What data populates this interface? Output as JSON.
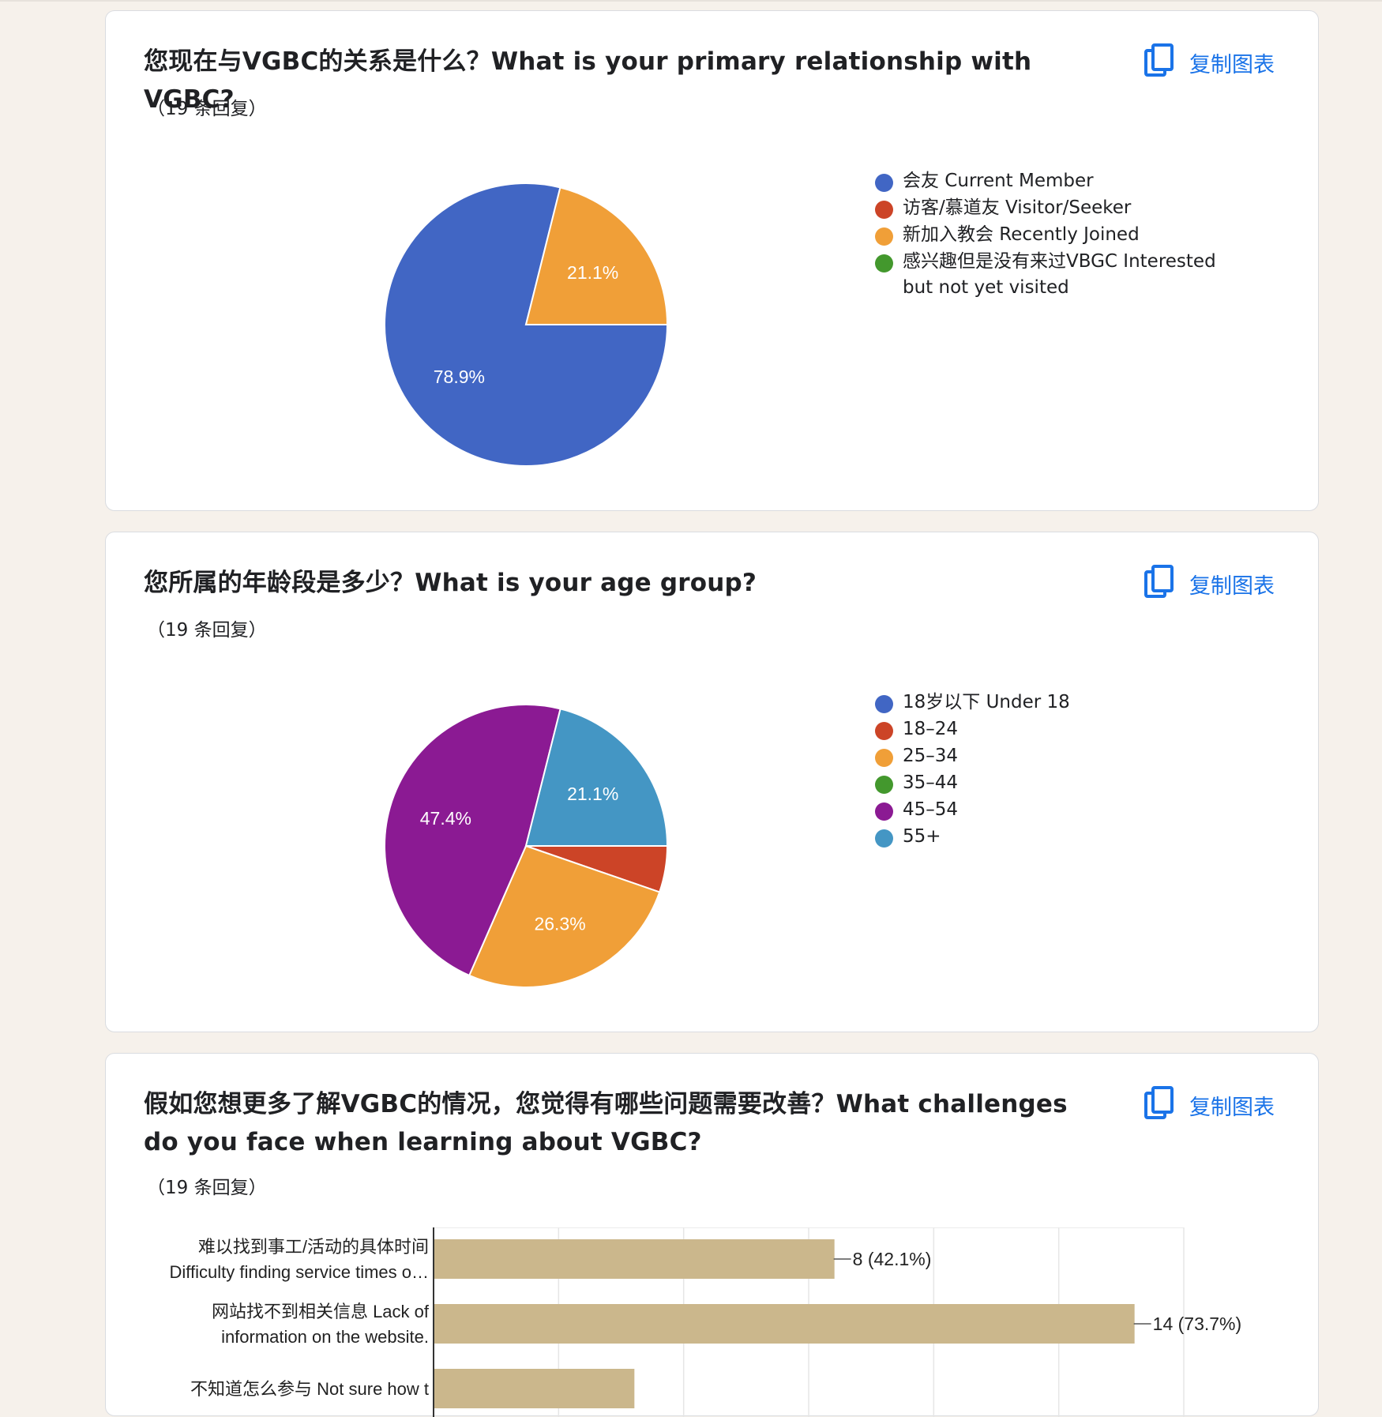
{
  "cards": [
    {
      "title": "您现在与VGBC的关系是什么？What is your primary relationship with VGBC?",
      "responses": "（19 条回复）",
      "copy_label": "复制图表",
      "legend": [
        {
          "label": "会友 Current Member",
          "color": "#4166c4"
        },
        {
          "label": "访客/慕道友 Visitor/Seeker",
          "color": "#cc4427"
        },
        {
          "label": "新加入教会 Recently Joined",
          "color": "#f09f38"
        },
        {
          "label": "感兴趣但是没有来过VBGC Interested but not yet visited",
          "color": "#43982d"
        }
      ]
    },
    {
      "title": "您所属的年龄段是多少？What is your age group?",
      "responses": "（19 条回复）",
      "copy_label": "复制图表",
      "legend": [
        {
          "label": "18岁以下 Under 18",
          "color": "#4166c4"
        },
        {
          "label": "18–24",
          "color": "#cc4427"
        },
        {
          "label": "25–34",
          "color": "#f09f38"
        },
        {
          "label": "35–44",
          "color": "#43982d"
        },
        {
          "label": "45–54",
          "color": "#8b1a93"
        },
        {
          "label": "55+",
          "color": "#4496c4"
        }
      ]
    },
    {
      "title": "假如您想更多了解VGBC的情况，您觉得有哪些问题需要改善？What challenges do you face when learning about VGBC?",
      "responses": "（19 条回复）",
      "copy_label": "复制图表"
    }
  ],
  "chart_data": [
    {
      "type": "pie",
      "slices": [
        {
          "label": "会友 Current Member",
          "value": 78.9,
          "color": "#4166c4",
          "data_label": "78.9%"
        },
        {
          "label": "访客/慕道友 Visitor/Seeker",
          "value": 0,
          "color": "#cc4427"
        },
        {
          "label": "新加入教会 Recently Joined",
          "value": 21.1,
          "color": "#f09f38",
          "data_label": "21.1%"
        },
        {
          "label": "感兴趣但是没有来过VBGC Interested but not yet visited",
          "value": 0,
          "color": "#43982d"
        }
      ],
      "legend_position": "right"
    },
    {
      "type": "pie",
      "slices": [
        {
          "label": "18岁以下 Under 18",
          "value": 0,
          "color": "#4166c4"
        },
        {
          "label": "18–24",
          "value": 5.3,
          "color": "#cc4427"
        },
        {
          "label": "25–34",
          "value": 26.3,
          "color": "#f09f38",
          "data_label": "26.3%"
        },
        {
          "label": "35–44",
          "value": 0,
          "color": "#43982d"
        },
        {
          "label": "45–54",
          "value": 47.4,
          "color": "#8b1a93",
          "data_label": "47.4%"
        },
        {
          "label": "55+",
          "value": 21.1,
          "color": "#4496c4",
          "data_label": "21.1%"
        }
      ],
      "legend_position": "right"
    },
    {
      "type": "bar",
      "orientation": "horizontal",
      "bar_color": "#cbb78c",
      "categories": [
        [
          "难以找到事工/活动的具体时间",
          "Difficulty finding service times o…"
        ],
        [
          "网站找不到相关信息 Lack of",
          "information on the website."
        ],
        [
          "不知道怎么参与 Not sure how t"
        ]
      ],
      "values": [
        8,
        14,
        4
      ],
      "data_labels": [
        "8 (42.1%)",
        "14 (73.7%)",
        ""
      ],
      "xlim": [
        0,
        15
      ]
    }
  ]
}
